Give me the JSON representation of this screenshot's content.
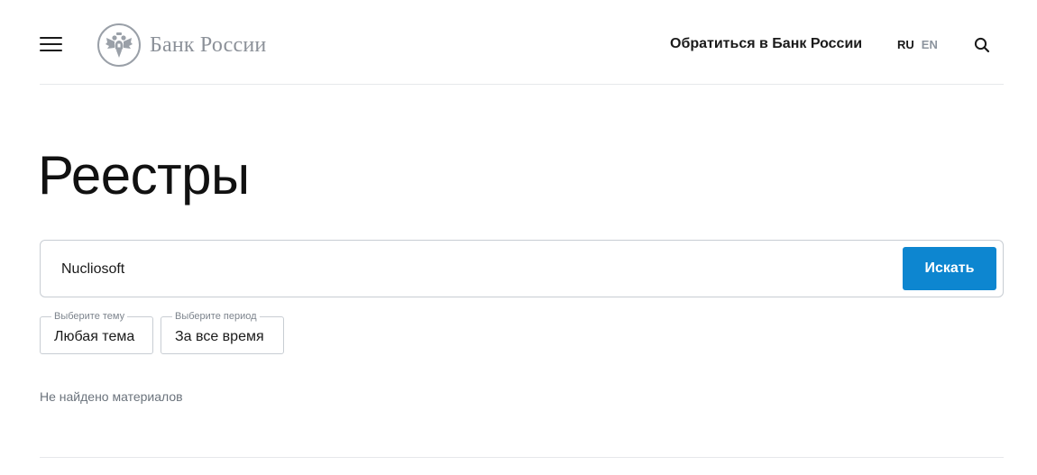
{
  "header": {
    "logo_text": "Банк России",
    "contact_link": "Обратиться в Банк России",
    "lang_ru": "RU",
    "lang_en": "EN"
  },
  "main": {
    "title": "Реестры",
    "search": {
      "value": "Nucliosoft",
      "button_label": "Искать"
    },
    "filters": [
      {
        "legend": "Выберите тему",
        "value": "Любая тема"
      },
      {
        "legend": "Выберите период",
        "value": "За все время"
      }
    ],
    "empty_message": "Не найдено материалов"
  },
  "colors": {
    "accent": "#0d86d0",
    "logo": "#8c9199",
    "muted_text": "#6b737c"
  },
  "icons": {
    "menu": "hamburger-menu-icon",
    "emblem": "double-headed-eagle-emblem",
    "search": "magnifier-icon"
  }
}
